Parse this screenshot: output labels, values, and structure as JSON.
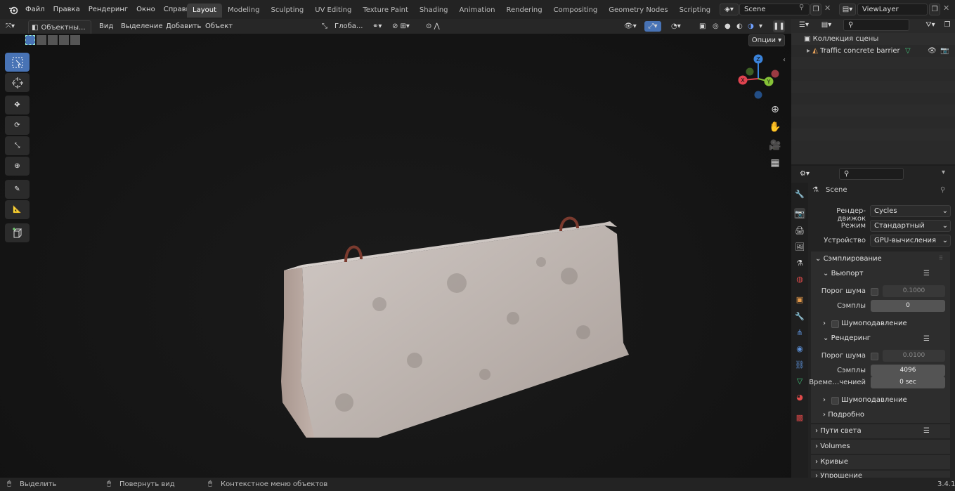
{
  "menu": {
    "items": [
      "Файл",
      "Правка",
      "Рендеринг",
      "Окно",
      "Справка"
    ]
  },
  "workspaces": [
    "Layout",
    "Modeling",
    "Sculpting",
    "UV Editing",
    "Texture Paint",
    "Shading",
    "Animation",
    "Rendering",
    "Compositing",
    "Geometry Nodes",
    "Scripting"
  ],
  "active_workspace": "Layout",
  "scene_field": "Scene",
  "viewlayer_field": "ViewLayer",
  "viewport_header": {
    "mode": "Объектны...",
    "menus": [
      "Вид",
      "Выделение",
      "Добавить",
      "Объект"
    ],
    "transform_orientation": "Глоба...",
    "options": "Опции"
  },
  "gizmo": {
    "x": "X",
    "y": "Y",
    "z": "Z"
  },
  "outliner": {
    "collection": "Коллекция сцены",
    "object": "Traffic concrete barrier"
  },
  "properties": {
    "scene_name": "Scene",
    "render_engine_label": "Рендер-движок",
    "render_engine": "Cycles",
    "mode_label": "Режим",
    "mode": "Стандартный",
    "device_label": "Устройство",
    "device": "GPU-вычисления",
    "sampling": "Сэмплирование",
    "viewport": "Вьюпорт",
    "noise_threshold_label": "Порог шума",
    "viewport_noise_threshold": "0.1000",
    "samples_label": "Сэмплы",
    "viewport_samples": "0",
    "denoise": "Шумоподавление",
    "render": "Рендеринг",
    "render_noise_threshold": "0.0100",
    "render_samples": "4096",
    "time_limit_label": "Време…ченией",
    "time_limit": "0 sec",
    "denoise2": "Шумоподавление",
    "advanced": "Подробно",
    "light_paths": "Пути света",
    "volumes": "Volumes",
    "curves": "Кривые",
    "simplify": "Упрощение"
  },
  "status": {
    "select": "Выделить",
    "rotate": "Повернуть вид",
    "context": "Контекстное меню объектов",
    "version": "3.4.1"
  },
  "colors": {
    "accent": "#4873b5",
    "gizmo_x": "#e0434f",
    "gizmo_y": "#86c237",
    "gizmo_z": "#3a83db"
  }
}
